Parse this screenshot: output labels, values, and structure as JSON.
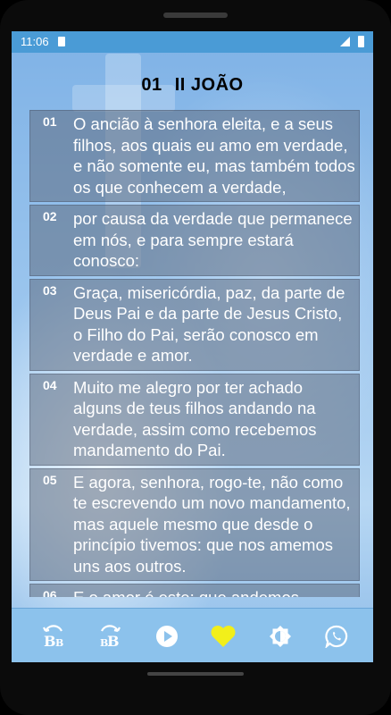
{
  "status_bar": {
    "time": "11:06"
  },
  "header": {
    "chapter": "01",
    "book": "II JOÃO"
  },
  "verses": [
    {
      "num": "01",
      "text": "O ancião à senhora eleita, e a seus filhos, aos quais eu amo em verdade, e não somente eu, mas também todos os que conhecem a verdade,"
    },
    {
      "num": "02",
      "text": "por causa da verdade que permanece em nós, e para sempre estará conosco:"
    },
    {
      "num": "03",
      "text": "Graça, misericórdia, paz, da parte de Deus Pai e da parte de Jesus Cristo, o Filho do Pai, serão conosco em verdade e amor."
    },
    {
      "num": "04",
      "text": "Muito me alegro por ter achado alguns de teus filhos andando na verdade, assim como recebemos mandamento do Pai."
    },
    {
      "num": "05",
      "text": "E agora, senhora, rogo-te, não como te escrevendo um novo mandamento, mas aquele mesmo que desde o princípio tivemos: que nos amemos uns aos outros."
    },
    {
      "num": "06",
      "text": "E o amor é este: que andemos"
    }
  ],
  "toolbar": {
    "buttons": [
      {
        "icon": "font-decrease-icon",
        "label": "BB"
      },
      {
        "icon": "font-increase-icon",
        "label": "BB"
      },
      {
        "icon": "play-icon"
      },
      {
        "icon": "heart-icon",
        "color": "#f2ef1a"
      },
      {
        "icon": "brightness-icon"
      },
      {
        "icon": "whatsapp-icon"
      }
    ]
  }
}
